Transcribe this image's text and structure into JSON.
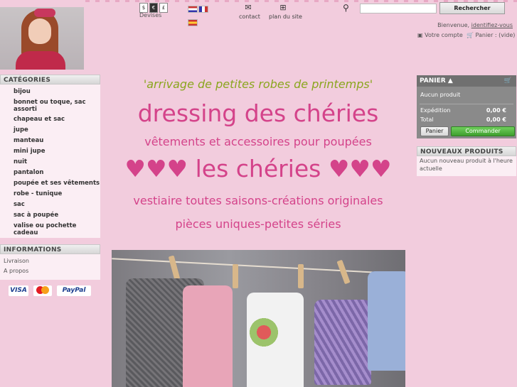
{
  "header": {
    "currencies": [
      "$",
      "€",
      "£"
    ],
    "devises_label": "Devises",
    "contact_label": "contact",
    "sitemap_label": "plan du site",
    "search": {
      "placeholder": "",
      "button_label": "Rechercher"
    },
    "welcome_text": "Bienvenue,",
    "login_link": "identifiez-vous",
    "account_label": "Votre compte",
    "cart_label": "Panier : (vide)"
  },
  "categories": {
    "title": "CATÉGORIES",
    "items": [
      "bijou",
      "bonnet ou toque, sac assorti",
      "chapeau et sac",
      "jupe",
      "manteau",
      "mini jupe",
      "nuit",
      "pantalon",
      "poupée et ses vêtements",
      "robe - tunique",
      "sac",
      "sac à poupée",
      "valise ou pochette cadeau"
    ]
  },
  "informations": {
    "title": "INFORMATIONS",
    "items": [
      "Livraison",
      "A propos"
    ]
  },
  "payment": [
    "VISA",
    "MasterCard",
    "PayPal"
  ],
  "main": {
    "line1": "'arrivage de petites robes de printemps'",
    "line2": "dressing des chéries",
    "line3": "vêtements et accessoires pour poupées",
    "line4": "♥♥♥ les chéries ♥♥♥",
    "line5": "vestiaire toutes saisons-créations originales",
    "line6": "pièces uniques-petites séries"
  },
  "cart": {
    "title": "PANIER",
    "empty_text": "Aucun produit",
    "shipping_label": "Expédition",
    "shipping_value": "0,00 €",
    "total_label": "Total",
    "total_value": "0,00 €",
    "cart_button": "Panier",
    "order_button": "Commander"
  },
  "new_products": {
    "title": "NOUVEAUX PRODUITS",
    "empty_text": "Aucun nouveau produit à l'heure actuelle"
  },
  "colors": {
    "background": "#f2ccdd",
    "title_pink": "#d4438a",
    "tagline_green": "#8aa61e",
    "order_green": "#4caf3a"
  }
}
